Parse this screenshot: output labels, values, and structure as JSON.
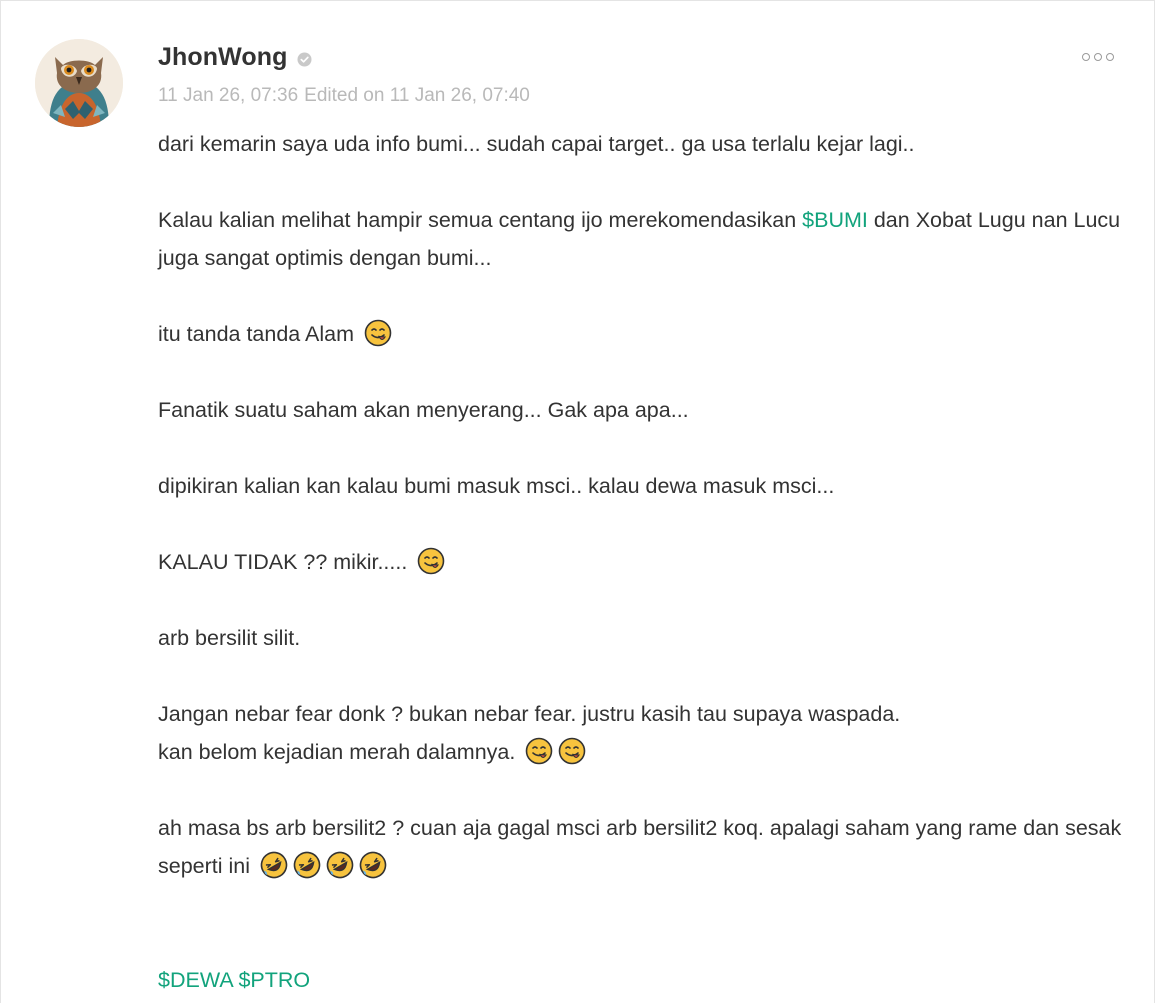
{
  "post": {
    "author": {
      "username": "JhonWong",
      "verified_icon": "verified-badge-icon"
    },
    "timestamp": "11 Jan 26, 07:36",
    "edited_label": "Edited on 11 Jan 26, 07:40",
    "more_icon": "more-options-icon",
    "paragraphs": {
      "p1": "dari kemarin saya uda info bumi... sudah capai target.. ga usa terlalu kejar lagi..",
      "p2_before": "Kalau kalian melihat hampir semua centang ijo merekomendasikan ",
      "p2_cashtag": "$BUMI",
      "p2_after": " dan Xobat Lugu nan Lucu juga sangat optimis dengan bumi...",
      "p3": "itu tanda tanda Alam ",
      "p4": "Fanatik suatu saham akan menyerang... Gak apa apa...",
      "p5": "dipikiran kalian kan kalau bumi masuk msci.. kalau dewa masuk msci...",
      "p6": "KALAU TIDAK ?? mikir..... ",
      "p7": "arb bersilit silit.",
      "p8_line1": "Jangan nebar fear donk ? bukan nebar fear. justru kasih tau supaya waspada.",
      "p8_line2": "kan belom kejadian merah dalamnya. ",
      "p9": "ah masa bs arb bersilit2 ? cuan aja gagal msci arb bersilit2 koq. apalagi saham yang rame dan sesak seperti ini "
    },
    "emojis": {
      "yum": "face-savoring-food-icon",
      "rofl": "rolling-on-floor-laughing-icon"
    },
    "tags": {
      "tag1": "$DEWA",
      "tag2": "$PTRO"
    },
    "colors": {
      "cashtag": "#12a37c",
      "meta": "#b9b9b9",
      "text": "#333333"
    }
  }
}
